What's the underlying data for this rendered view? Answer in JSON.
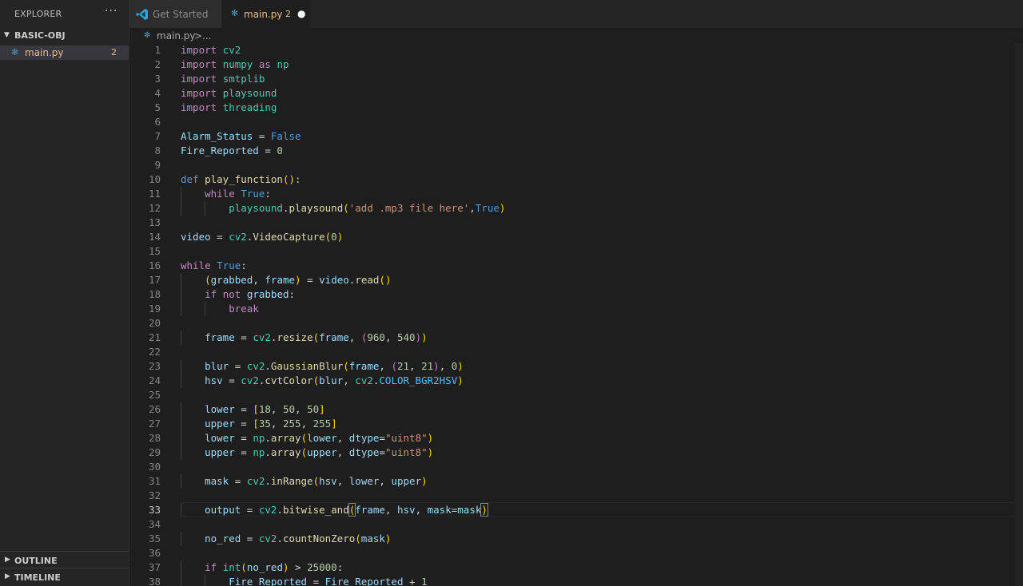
{
  "sidebar": {
    "title": "EXPLORER",
    "more_icon": "ellipsis-icon",
    "folder": "BASIC-OBJ",
    "file": {
      "name": "main.py",
      "problems": "2",
      "icon": "python-icon"
    },
    "outline_label": "OUTLINE",
    "timeline_label": "TIMELINE"
  },
  "tabs": [
    {
      "label": "Get Started",
      "icon": "vscode-logo-icon"
    },
    {
      "label": "main.py",
      "problems": "2",
      "icon": "python-icon",
      "dirty": "●"
    }
  ],
  "breadcrumb": {
    "file": "main.py",
    "separator": ">",
    "rest": "..."
  },
  "editor": {
    "active_line": 33,
    "lines": [
      "import cv2",
      "import numpy as np",
      "import smtplib",
      "import playsound",
      "import threading",
      "",
      "Alarm_Status = False",
      "Fire_Reported = 0",
      "",
      "def play_function():",
      "    while True:",
      "        playsound.playsound('add .mp3 file here',True)",
      "",
      "video = cv2.VideoCapture(0)",
      "",
      "while True:",
      "    (grabbed, frame) = video.read()",
      "    if not grabbed:",
      "        break",
      "",
      "    frame = cv2.resize(frame, (960, 540))",
      "",
      "    blur = cv2.GaussianBlur(frame, (21, 21), 0)",
      "    hsv = cv2.cvtColor(blur, cv2.COLOR_BGR2HSV)",
      "",
      "    lower = [18, 50, 50]",
      "    upper = [35, 255, 255]",
      "    lower = np.array(lower, dtype=\"uint8\")",
      "    upper = np.array(upper, dtype=\"uint8\")",
      "",
      "    mask = cv2.inRange(hsv, lower, upper)",
      "",
      "    output = cv2.bitwise_and(frame, hsv, mask=mask)",
      "",
      "    no_red = cv2.countNonZero(mask)",
      "",
      "    if int(no_red) > 25000:",
      "        Fire_Reported = Fire_Reported + 1"
    ]
  },
  "colors": {
    "editor_bg": "#1e1e1e",
    "sidebar_bg": "#252526",
    "keyword_import": "#c586c0",
    "keyword_def": "#569cd6",
    "function": "#dcdcaa",
    "variable": "#9cdcfe",
    "string": "#ce9178",
    "number": "#b5cea8",
    "modified_file": "#e2c08d"
  }
}
